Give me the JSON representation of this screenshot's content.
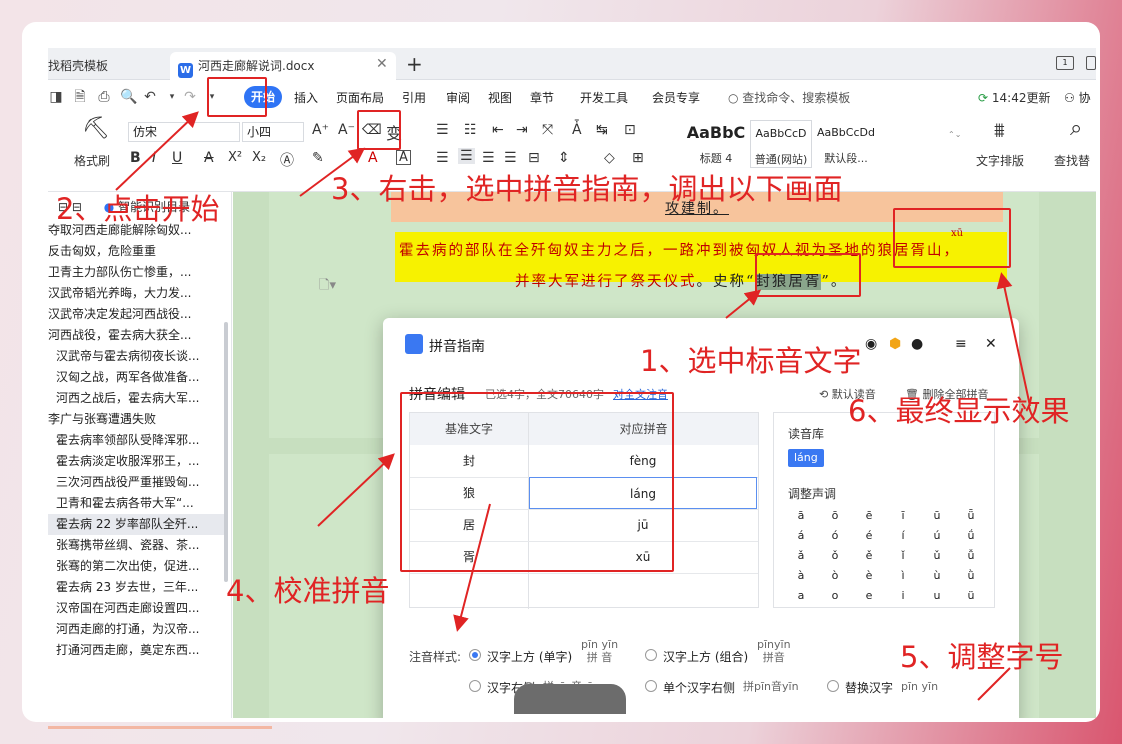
{
  "tabs": {
    "t1": "找稻壳模板",
    "t2": "河西走廊解说词.docx",
    "doc_icon": "W"
  },
  "menu": {
    "start": "开始",
    "items": [
      "插入",
      "页面布局",
      "引用",
      "审阅",
      "视图",
      "章节",
      "开发工具",
      "会员专享"
    ],
    "search": "查找命令、搜索模板",
    "update": "14:42更新",
    "collab": "协"
  },
  "ribbon": {
    "format_brush": "格式刷",
    "font_name": "仿宋",
    "font_size": "小四",
    "pinyin_glyph": "变",
    "styles": [
      {
        "sample": "AaBbC",
        "name": "标题 4"
      },
      {
        "sample": "AaBbCcD",
        "name": "普通(网站)"
      },
      {
        "sample": "AaBbCcDd",
        "name": "默认段..."
      }
    ],
    "text_layout": "文字排版",
    "find_replace": "查找替"
  },
  "sidebar": {
    "header": "智能识别目录",
    "items": [
      "夺取河西走廊能解除匈奴...",
      "反击匈奴，危险重重",
      "卫青主力部队伤亡惨重，...",
      "汉武帝韬光养晦，大力发...",
      "汉武帝决定发起河西战役...",
      "河西战役，霍去病大获全...",
      "汉武帝与霍去病彻夜长谈...",
      "汉匈之战，两军各做准备...",
      "河西之战后，霍去病大军...",
      "李广与张骞遭遇失败",
      "霍去病率领部队受降浑邪...",
      "霍去病淡定收服浑邪王，...",
      "三次河西战役严重摧毁匈...",
      "卫青和霍去病各带大军“...",
      "霍去病 22 岁率部队全歼...",
      "张骞携带丝绸、瓷器、茶...",
      "张骞的第二次出使，促进...",
      "霍去病 23 岁去世，三年...",
      "汉帝国在河西走廊设置四...",
      "河西走廊的打通，为汉帝...",
      "打通河西走廊，奠定东西..."
    ]
  },
  "doc": {
    "title_partial": "攻建制。",
    "line1": "霍去病的部队在全歼匈奴主力之后，一路冲到被匈奴人视为圣地的狼居胥山，",
    "line2_red": "并率大军进行了祭天仪式",
    "line2_black": "。史称“",
    "selected": "封狼居胥",
    "line2_end": "”。",
    "pinyin_xu": "xū"
  },
  "dialog": {
    "title": "拼音指南",
    "section": "拼音编辑",
    "meta": "已选4字，全文70640字",
    "link": "对全文注音",
    "default_btn": "默认读音",
    "delete_btn": "删除全部拼音",
    "col_base": "基准文字",
    "col_pinyin": "对应拼音",
    "rows": [
      {
        "char": "封",
        "pinyin": "fèng"
      },
      {
        "char": "狼",
        "pinyin": "láng"
      },
      {
        "char": "居",
        "pinyin": "jū"
      },
      {
        "char": "胥",
        "pinyin": "xū"
      }
    ],
    "lib_title": "读音库",
    "lib_value": "láng",
    "tone_title": "调整声调",
    "tones": [
      [
        "ā",
        "ō",
        "ē",
        "ī",
        "ū",
        "ǖ"
      ],
      [
        "á",
        "ó",
        "é",
        "í",
        "ú",
        "ǘ"
      ],
      [
        "ǎ",
        "ǒ",
        "ě",
        "ǐ",
        "ǔ",
        "ǚ"
      ],
      [
        "à",
        "ò",
        "è",
        "ì",
        "ù",
        "ǜ"
      ],
      [
        "a",
        "o",
        "e",
        "i",
        "u",
        "ü"
      ]
    ],
    "style_label": "注音样式:",
    "opt1": "汉字上方 (单字)",
    "opt1_demo_top": "pīn yīn",
    "opt1_demo_bot": "拼 音",
    "opt2": "汉字上方 (组合)",
    "opt2_demo_top": "pīnyīn",
    "opt2_demo_bot": "拼音",
    "opt3": "汉字右侧",
    "opt3_demo": "拼pīn音yīn",
    "opt4": "单个汉字右侧",
    "opt4_demo": "拼pīn音yīn",
    "opt5": "替换汉字",
    "opt5_demo": "pīn yīn"
  },
  "annotations": {
    "a1": "1、选中标音文字",
    "a2": "2、点击开始",
    "a3": "3、右击，选中拼音指南，调出以下画面",
    "a4": "4、校准拼音",
    "a5": "5、调整字号",
    "a6": "6、最终显示效果"
  },
  "colors": {
    "accent": "#2f74f5",
    "annotation": "#e02424",
    "doc_bg": "#c7dfbf",
    "highlight_yellow": "#f7f200",
    "highlight_orange": "#f7c49c"
  }
}
